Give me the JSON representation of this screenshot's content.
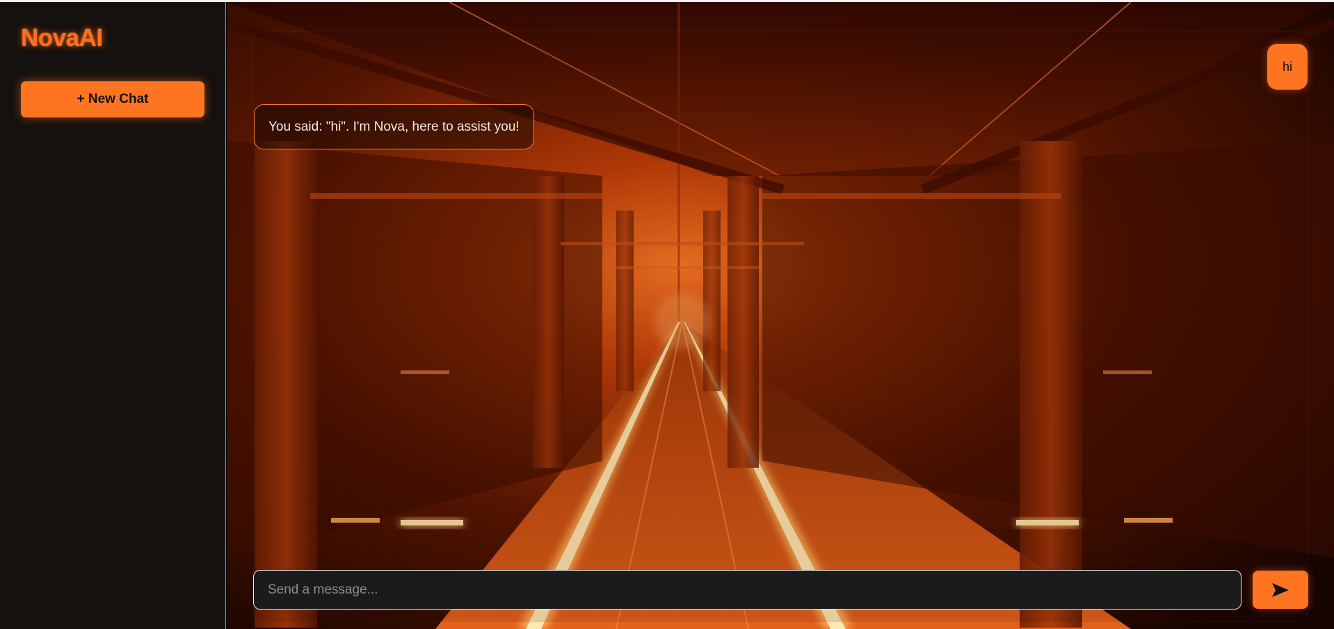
{
  "app": {
    "title": "NovaAI"
  },
  "sidebar": {
    "new_chat_label": "+ New Chat"
  },
  "chat": {
    "messages": [
      {
        "role": "user",
        "text": "hi"
      },
      {
        "role": "assistant",
        "text": "You said: \"hi\". I'm Nova, here to assist you!"
      }
    ]
  },
  "composer": {
    "placeholder": "Send a message...",
    "value": "",
    "send_icon": "send-arrow-icon"
  },
  "theme": {
    "accent": "#ff7420",
    "sidebar_bg": "#14110f",
    "input_bg": "#1b1b1b"
  }
}
